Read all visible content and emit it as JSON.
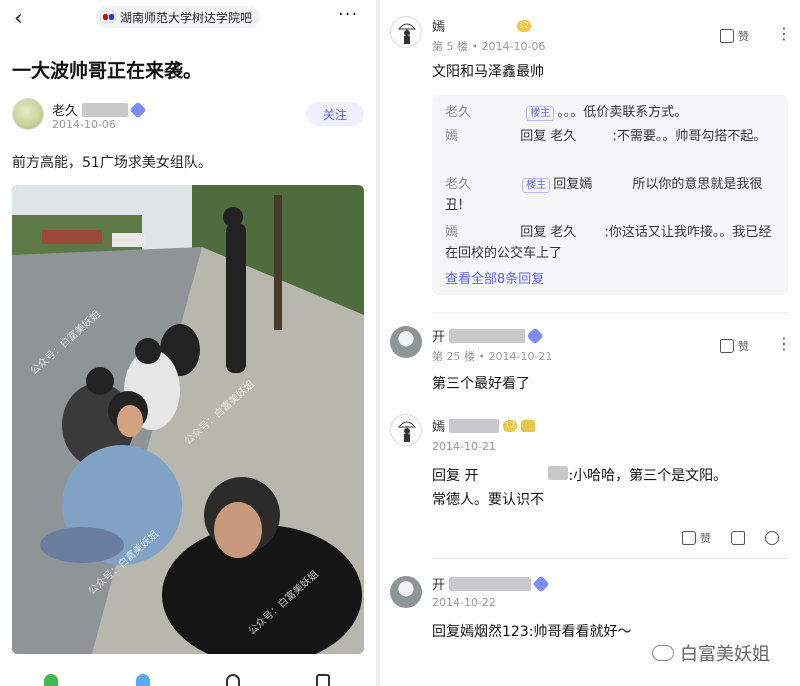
{
  "left": {
    "back_glyph": "‹",
    "forum_name": "湖南师范大学树达学院吧",
    "more_glyph": "···",
    "title": "一大波帅哥正在来袭。",
    "op": {
      "name": "老久",
      "date": "2014-10-06",
      "follow_label": "关注"
    },
    "body": "前方高能，51广场求美女组队。",
    "photo_watermark": "公众号：白富美妖姐"
  },
  "right": {
    "comments": [
      {
        "name": "嫣",
        "level": "12",
        "floor": "第 5 楼",
        "date": "2014-10-06",
        "like_label": "赞",
        "text": "文阳和马泽鑫最帅",
        "replies": [
          {
            "name": "老久",
            "tag": "楼主",
            "text": "。。。低价卖联系方式。"
          },
          {
            "name": "嫣",
            "prefix": "回复 老久",
            "text": ":不需要。。帅哥勾搭不起。"
          },
          {
            "name": "老久",
            "tag": "楼主",
            "prefix": "回复嫣",
            "text": "所以你的意思就是我很丑!"
          },
          {
            "name": "嫣",
            "prefix": "回复 老久",
            "text": ":你这话又让我咋接。。我已经在回校的公交车上了"
          }
        ],
        "view_all": "查看全部8条回复"
      },
      {
        "name": "开",
        "floor": "第 25 楼",
        "date": "2014-10-21",
        "like_label": "赞",
        "text": "第三个最好看了"
      },
      {
        "name": "嫣",
        "level": "12",
        "date": "2014-10-21",
        "text_line1_prefix": "回复 开",
        "text_line1": ":小哈哈，第三个是文阳。",
        "text_line2": "常德人。要认识不",
        "like_label": "赞"
      },
      {
        "name": "开",
        "date": "2014-10-22",
        "text": "回复嫣烟然123:帅哥看看就好～"
      }
    ],
    "signature": "白富美妖姐"
  }
}
